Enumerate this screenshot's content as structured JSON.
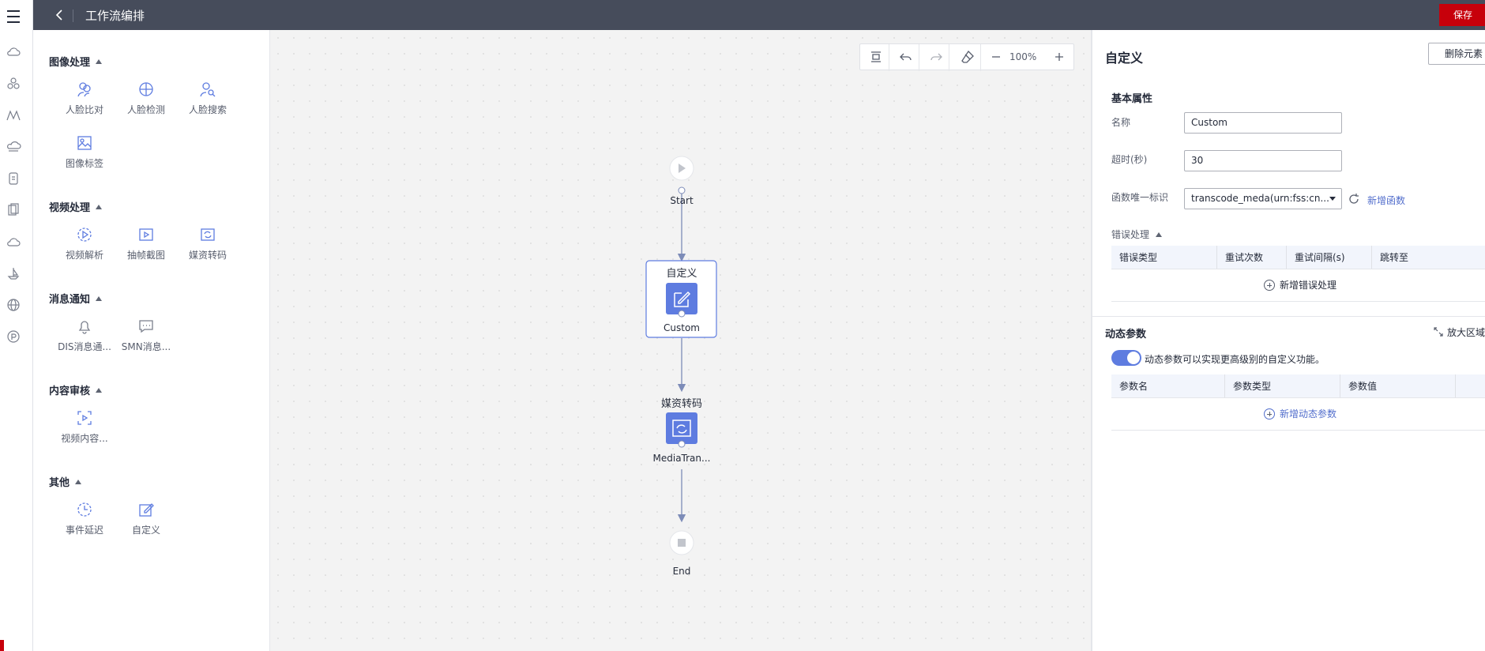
{
  "header": {
    "title": "工作流编排",
    "save_label": "保存"
  },
  "rail": {
    "icons": [
      "menu-icon",
      "cloud-icon",
      "cluster-icon",
      "trend-icon",
      "cloud-stack-icon",
      "device-icon",
      "document-icon",
      "cloud-outline-icon",
      "ship-icon",
      "globe-icon",
      "badge-icon"
    ]
  },
  "palette": {
    "groups": [
      {
        "title": "图像处理",
        "items": [
          {
            "label": "人脸比对",
            "icon": "face-compare-icon"
          },
          {
            "label": "人脸检测",
            "icon": "face-detect-icon"
          },
          {
            "label": "人脸搜索",
            "icon": "face-search-icon"
          },
          {
            "label": "图像标签",
            "icon": "image-tag-icon"
          }
        ]
      },
      {
        "title": "视频处理",
        "items": [
          {
            "label": "视频解析",
            "icon": "video-parse-icon"
          },
          {
            "label": "抽帧截图",
            "icon": "frame-capture-icon"
          },
          {
            "label": "媒资转码",
            "icon": "transcode-icon"
          }
        ]
      },
      {
        "title": "消息通知",
        "items": [
          {
            "label": "DIS消息通...",
            "icon": "bell-icon"
          },
          {
            "label": "SMN消息...",
            "icon": "message-icon"
          }
        ]
      },
      {
        "title": "内容审核",
        "items": [
          {
            "label": "视频内容...",
            "icon": "video-audit-icon"
          }
        ]
      },
      {
        "title": "其他",
        "items": [
          {
            "label": "事件延迟",
            "icon": "clock-icon"
          },
          {
            "label": "自定义",
            "icon": "edit-icon"
          }
        ]
      }
    ]
  },
  "toolbar": {
    "zoom": "100%",
    "buttons": [
      "fit-icon",
      "undo-icon",
      "redo-icon",
      "eraser-icon",
      "zoom-out-icon",
      "zoom-in-icon"
    ]
  },
  "flow": {
    "start_label": "Start",
    "custom_title": "自定义",
    "custom_label": "Custom",
    "transcode_title": "媒资转码",
    "transcode_label": "MediaTran...",
    "end_label": "End"
  },
  "props": {
    "title": "自定义",
    "delete_label": "删除元素",
    "basic_section": "基本属性",
    "name_label": "名称",
    "name_value": "Custom",
    "timeout_label": "超时(秒)",
    "timeout_value": "30",
    "func_label": "函数唯一标识",
    "func_value": "transcode_meda(urn:fss:cn...",
    "new_func_label": "新增函数",
    "error_section": "错误处理",
    "error_columns": [
      "错误类型",
      "重试次数",
      "重试间隔(s)",
      "跳转至"
    ],
    "add_error_label": "新增错误处理",
    "dynamic_section": "动态参数",
    "expand_label": "放大区域",
    "toggle_desc": "动态参数可以实现更高级别的自定义功能。",
    "param_columns": [
      "参数名",
      "参数类型",
      "参数值"
    ],
    "add_param_label": "新增动态参数"
  },
  "colors": {
    "topbar": "#464c5b",
    "save": "#c7000b",
    "accent": "#5e7ce0",
    "node": "#5e7ce0"
  }
}
